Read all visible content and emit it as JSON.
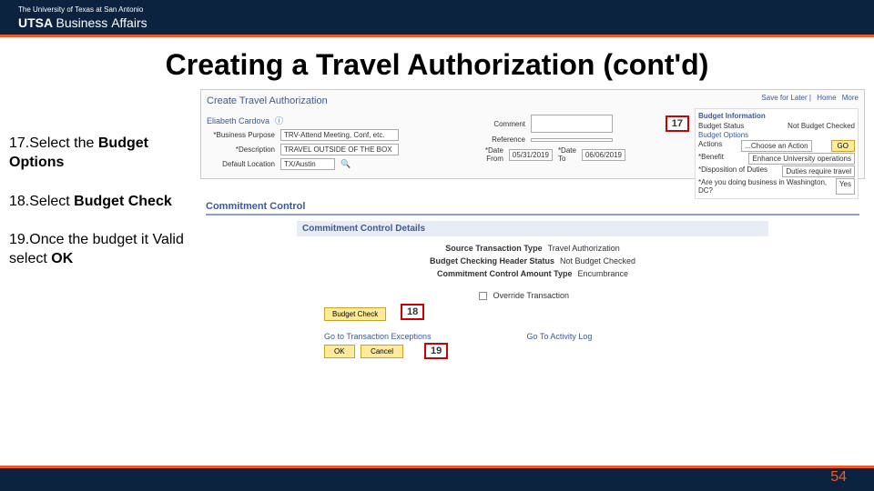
{
  "header": {
    "university": "The University of Texas at San Antonio",
    "logo_main": "UTSA",
    "logo_sub1": "Business",
    "logo_sub2": "Affairs"
  },
  "title": "Creating a Travel Authorization (cont'd)",
  "steps": [
    {
      "num": "17.",
      "text": "Select the ",
      "bold": "Budget Options"
    },
    {
      "num": "18.",
      "text": "Select ",
      "bold": "Budget Check"
    },
    {
      "num": "19.",
      "text": "Once the budget it Valid select ",
      "bold": "OK"
    }
  ],
  "panel": {
    "title": "Create Travel Authorization",
    "links": {
      "save": "Save for Later",
      "home": "Home",
      "more": "More"
    },
    "employee": "Eliabeth Cardova",
    "business_purpose_label": "*Business Purpose",
    "business_purpose_value": "TRV-Attend Meeting, Conf, etc.",
    "description_label": "*Description",
    "description_value": "TRAVEL OUTSIDE OF THE BOX",
    "default_location_label": "Default Location",
    "default_location_value": "TX/Austin",
    "comment_label": "Comment",
    "reference_label": "Reference",
    "date_from_label": "*Date From",
    "date_from_value": "05/31/2019",
    "date_to_label": "*Date To",
    "date_to_value": "06/06/2019"
  },
  "budget_box": {
    "header": "Budget Information",
    "status_label": "Budget Status",
    "status_value": "Not Budget Checked",
    "options_label": "Budget Options",
    "actions_label": "Actions",
    "actions_value": "...Choose an Action",
    "go": "GO",
    "benefit_label": "*Benefit",
    "benefit_value": "Enhance University operations",
    "disposition_label": "*Disposition of Duties",
    "disposition_value": "Duties require travel",
    "dc_label": "*Are you doing business in Washington, DC?",
    "dc_value": "Yes"
  },
  "commitment": {
    "title": "Commitment Control",
    "details": "Commitment Control Details",
    "row1_label": "Source Transaction Type",
    "row1_value": "Travel Authorization",
    "row2_label": "Budget Checking Header Status",
    "row2_value": "Not Budget Checked",
    "row3_label": "Commitment Control Amount Type",
    "row3_value": "Encumbrance",
    "override": "Override Transaction",
    "budget_check": "Budget Check",
    "exceptions": "Go to Transaction Exceptions",
    "activity_log": "Go To Activity Log",
    "ok": "OK",
    "cancel": "Cancel"
  },
  "callouts": {
    "c17": "17",
    "c18": "18",
    "c19": "19"
  },
  "page_number": "54"
}
